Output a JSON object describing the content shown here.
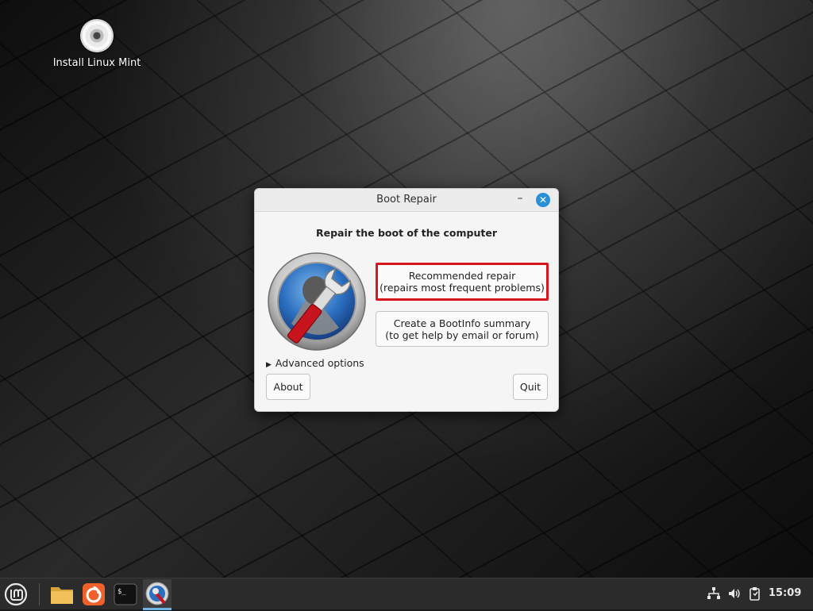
{
  "desktop": {
    "icons": [
      {
        "label": "Install Linux Mint",
        "icon": "cd-icon"
      }
    ]
  },
  "window": {
    "title": "Boot Repair",
    "minimize_symbol": "–",
    "close_symbol": "✕",
    "heading": "Repair the boot of the computer",
    "logo_icon": "boot-repair-wrench-logo",
    "recommended_button": {
      "line1": "Recommended repair",
      "line2": "(repairs most frequent problems)",
      "highlight_color": "#d9151e"
    },
    "bootinfo_button": {
      "line1": "Create a BootInfo summary",
      "line2": "(to get help by email or forum)"
    },
    "advanced_options": "Advanced options",
    "about_label": "About",
    "quit_label": "Quit"
  },
  "taskbar": {
    "apps": [
      {
        "name": "menu",
        "icon": "mint-menu-icon"
      },
      {
        "name": "files",
        "icon": "folder-icon"
      },
      {
        "name": "firefox",
        "icon": "firefox-icon"
      },
      {
        "name": "terminal",
        "icon": "terminal-icon"
      },
      {
        "name": "boot-repair",
        "icon": "boot-repair-icon",
        "active": true
      }
    ],
    "tray": [
      "network-icon",
      "volume-icon",
      "clipboard-icon"
    ],
    "clock": "15:09"
  },
  "colors": {
    "accent": "#2a8fd6",
    "taskbar": "#2b2b2b",
    "window_bg": "#f5f5f5"
  }
}
